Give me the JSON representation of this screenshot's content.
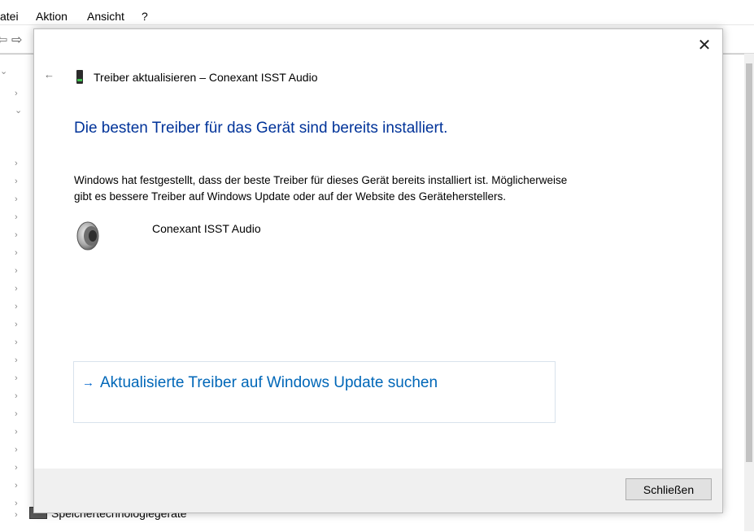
{
  "menubar": {
    "items": [
      "atei",
      "Aktion",
      "Ansicht",
      "?"
    ]
  },
  "dialog": {
    "title": "Treiber aktualisieren – Conexant ISST Audio",
    "heading": "Die besten Treiber für das Gerät sind bereits installiert.",
    "paragraph_line1": "Windows hat festgestellt, dass der beste Treiber für dieses Gerät bereits installiert ist. Möglicherweise",
    "paragraph_line2": "gibt es bessere Treiber auf Windows Update oder auf der Website des Geräteherstellers.",
    "device_name": "Conexant ISST Audio",
    "update_link": "Aktualisierte Treiber auf Windows Update suchen",
    "close_button": "Schließen",
    "close_glyph": "✕",
    "back_glyph": "←",
    "link_arrow": "→"
  },
  "tree": {
    "last_item": "Speichertechnologiegeräte"
  },
  "icons": [
    "back-icon",
    "close-icon",
    "device-icon",
    "speaker-icon",
    "forward-arrow-icon"
  ]
}
